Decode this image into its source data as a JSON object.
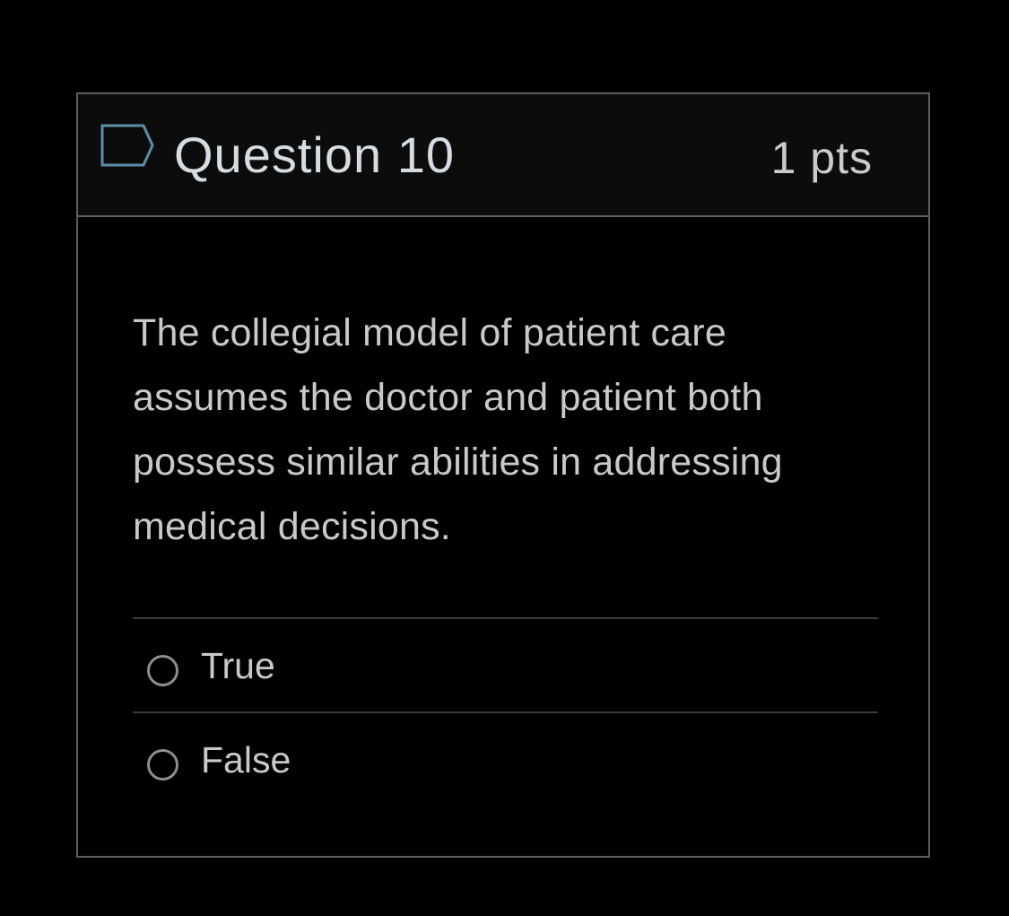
{
  "question": {
    "flag_icon": "flag-icon",
    "title": "Question 10",
    "points": "1 pts",
    "text": "The collegial model of patient care assumes the doctor and patient both possess similar abilities in addressing medical decisions."
  },
  "answers": [
    {
      "label": "True",
      "selected": false
    },
    {
      "label": "False",
      "selected": false
    }
  ],
  "colors": {
    "background": "#000000",
    "header_background": "#0c0c0c",
    "border": "#5e5e5e",
    "flag_outline": "#5b8fa8"
  }
}
